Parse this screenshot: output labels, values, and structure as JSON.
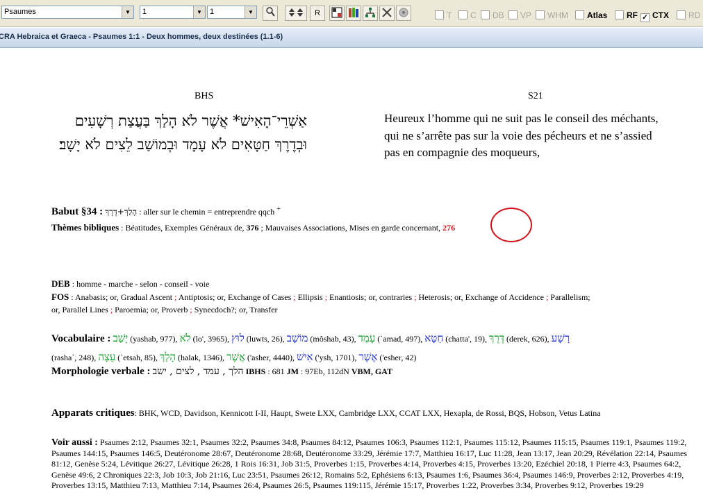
{
  "toolbar": {
    "book_combo": "Psaumes",
    "chapter_combo": "1",
    "verse_combo": "1",
    "r_button": "R",
    "checkboxes": [
      {
        "label": "T",
        "checked": false,
        "enabled": false
      },
      {
        "label": "C",
        "checked": false,
        "enabled": false
      },
      {
        "label": "DB",
        "checked": false,
        "enabled": false
      },
      {
        "label": "VP",
        "checked": false,
        "enabled": false
      },
      {
        "label": "WHM",
        "checked": false,
        "enabled": false
      },
      {
        "label": "Atlas",
        "checked": false,
        "enabled": true
      },
      {
        "label": "RF",
        "checked": false,
        "enabled": true
      },
      {
        "label": "CTX",
        "checked": true,
        "enabled": true
      },
      {
        "label": "RD",
        "checked": false,
        "enabled": false
      }
    ]
  },
  "titlebar": {
    "title": "CRA Hebraica et Graeca - Psaumes 1:1 - Deux hommes, deux destinées (1.1-6)"
  },
  "columns": {
    "left_header": "BHS",
    "right_header": "S21",
    "hebrew_line1": "אַשְׁרֵי־הָאִישׁ* אֲשֶׁר לֹא הָלַךְ בַּעֲצַת רְשָׁעִים",
    "hebrew_line2": "וּבְדֶרֶךְ חַטָּאִים לֹא עָמָד וּבְמוֹשַׁב לֵצִים לֹא יָשָׁב׃",
    "french_line1": "Heureux l’homme qui ne suit pas le conseil des méchants,",
    "french_line2": "qui ne s’arrête pas sur la voie des pécheurs et ne s’assied",
    "french_line3": "pas en compagnie des moqueurs,"
  },
  "babut": {
    "label": "Babut §34 :",
    "hebrew": "הָלַךְ+דֶּרֶךְ",
    "text": ": aller sur le chemin = entreprendre qqch",
    "sup": "+"
  },
  "themes": {
    "label": "Thèmes bibliques",
    "text1": ": Béatitudes, Exemples Généraux de,",
    "num1": "376",
    "text2": "; Mauvaises Associations, Mises en garde concernant,",
    "num2": "276"
  },
  "deb": {
    "label": "DEB",
    "text": ": homme - marche - selon - conseil - voie"
  },
  "fos": {
    "label": "FOS",
    "items": [
      ": Anabasis; or, Gradual Ascent",
      "Antiptosis; or, Exchange of Cases",
      "Ellipsis",
      "Enantiosis; or, contraries",
      "Heterosis; or, Exchange of Accidence",
      "Parallelism;",
      "or, Parallel Lines",
      "Paroemia; or, Proverb",
      "Synecdoch?; or, Transfer"
    ]
  },
  "vocabulaire": {
    "label": "Vocabulaire :",
    "items": [
      {
        "heb": "יָשַׁב",
        "tr": "(yashab, 977),",
        "color": "grn"
      },
      {
        "heb": "לֹא",
        "tr": "(lo', 3965),",
        "color": "grn"
      },
      {
        "heb": "לוּץ",
        "tr": "(luwts, 26),",
        "color": "blu"
      },
      {
        "heb": "מוֹשָׁב",
        "tr": "(môshab, 43),",
        "color": "blu"
      },
      {
        "heb": "עָמַד",
        "tr": "(`amad, 497),",
        "color": "grn"
      },
      {
        "heb": "חַטָּא",
        "tr": "(chatta', 19),",
        "color": "blu"
      },
      {
        "heb": "דֶּרֶךְ",
        "tr": "(derek, 626),",
        "color": "grn"
      },
      {
        "heb": "רָשָׁע",
        "tr": "(rasha`, 248),",
        "color": "blu"
      },
      {
        "heb": "עֵצָה",
        "tr": "(`etsah, 85),",
        "color": "grn"
      },
      {
        "heb": "הָלַךְ",
        "tr": "(halak, 1346),",
        "color": "grn"
      },
      {
        "heb": "אֲשֶׁר",
        "tr": "('asher, 4440),",
        "color": "grn"
      },
      {
        "heb": "אִישׁ",
        "tr": "('ysh, 1701),",
        "color": "blu"
      },
      {
        "heb": "אֶשֶׁר",
        "tr": "('esher, 42)",
        "color": "blu"
      }
    ]
  },
  "morphologie": {
    "label": "Morphologie verbale :",
    "heb": "הלך , עמד , לצים , ישב",
    "ibhs_label": "IBHS",
    "ibhs": ": 681",
    "jm_label": "JM",
    "jm": ": 97Eb, 112dN",
    "vbm": "VBM,",
    "gat": "GAT"
  },
  "apparats": {
    "label": "Apparats critiques",
    "text": ": BHK, WCD, Davidson, Kennicott I-II, Haupt, Swete LXX, Cambridge LXX, CCAT LXX, Hexapla, de Rossi, BQS, Hobson, Vetus Latina"
  },
  "voir_aussi": {
    "label": "Voir aussi :",
    "refs": "Psaumes 2:12, Psaumes 32:1, Psaumes 32:2, Psaumes 34:8, Psaumes 84:12, Psaumes 106:3, Psaumes 112:1, Psaumes 115:12, Psaumes 115:15, Psaumes 119:1, Psaumes 119:2, Psaumes 144:15, Psaumes 146:5, Deutéronome 28:67, Deutéronome 28:68, Deutéronome 33:29, Jérémie 17:7, Matthieu 16:17, Luc 11:28, Jean 13:17, Jean 20:29, Révélation 22:14, Psaumes 81:12, Genèse 5:24, Lévitique 26:27, Lévitique 26:28, 1 Rois 16:31, Job 31:5, Proverbes 1:15, Proverbes 4:14, Proverbes 4:15, Proverbes 13:20, Ezéchiel 20:18, 1 Pierre 4:3, Psaumes 64:2, Genèse 49:6, 2 Chroniques 22:3, Job 10:3, Job 21:16, Luc 23:51, Psaumes 26:12, Romains 5:2, Ephésiens 6:13, Psaumes 1:6, Psaumes 36:4, Psaumes 146:9, Proverbes 2:12, Proverbes 4:19, Proverbes 13:15, Matthieu 7:13, Matthieu 7:14, Psaumes 26:4, Psaumes 26:5, Psaumes 119:115, Jérémie 15:17, Proverbes 1:22, Proverbes 3:34, Proverbes 9:12, Proverbes 19:29"
  },
  "colors": {
    "red": "#d0131a",
    "green": "#119a26",
    "blue": "#1b2cc8",
    "annotation": "#d0131a"
  }
}
